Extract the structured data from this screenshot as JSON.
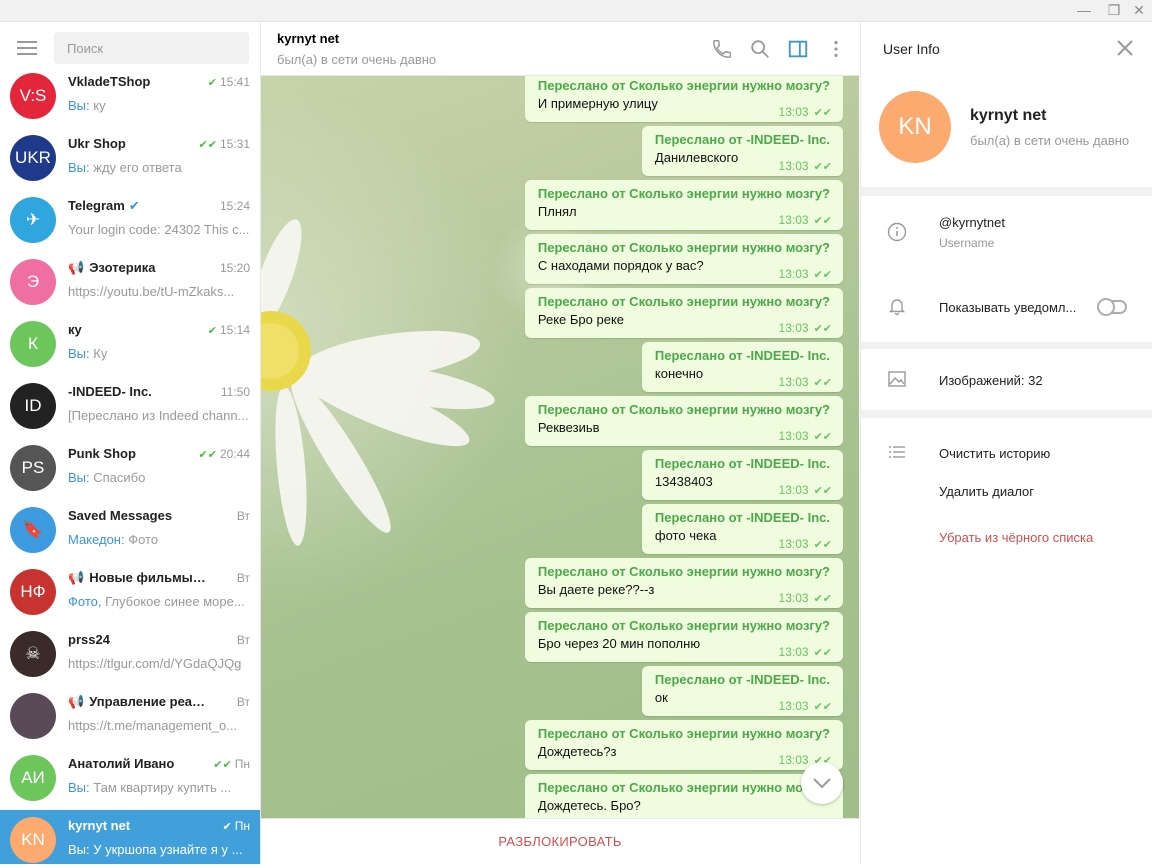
{
  "search": {
    "placeholder": "Поиск"
  },
  "chats": [
    {
      "name": "VkladeTShop",
      "time": "15:41",
      "check": "✔",
      "you": "Вы:",
      "preview": " ку",
      "avatar_text": "V:S",
      "avatar_color": "#e3263a",
      "icon": ""
    },
    {
      "name": "Ukr Shop",
      "time": "15:31",
      "check": "✔✔",
      "you": "Вы:",
      "preview": " жду его ответа",
      "avatar_text": "UKR",
      "avatar_color": "#1f3a8a",
      "icon": ""
    },
    {
      "name": "Telegram",
      "time": "15:24",
      "check": "",
      "you": "",
      "preview": "Your login code: 24302  This c...",
      "avatar_text": "✈",
      "avatar_color": "#2fa6de",
      "icon": "verified"
    },
    {
      "name": "Эзотерика",
      "time": "15:20",
      "check": "",
      "you": "",
      "preview": "https://youtu.be/tU-mZkaks...",
      "avatar_text": "Э",
      "avatar_color": "#ef6fa0",
      "icon": "megaphone"
    },
    {
      "name": "ку",
      "time": "15:14",
      "check": "✔",
      "you": "Вы:",
      "preview": " Ку",
      "avatar_text": "К",
      "avatar_color": "#6dc65b",
      "icon": ""
    },
    {
      "name": "-INDEED- Inc.",
      "time": "11:50",
      "check": "",
      "you": "",
      "preview": "[Переслано из Indeed chann...",
      "avatar_text": "ID",
      "avatar_color": "#222222",
      "icon": ""
    },
    {
      "name": "Punk Shop",
      "time": "20:44",
      "check": "✔✔",
      "you": "Вы:",
      "preview": " Спасибо",
      "avatar_text": "PS",
      "avatar_color": "#555555",
      "icon": ""
    },
    {
      "name": "Saved Messages",
      "time": "Вт",
      "check": "",
      "you": "Македон:",
      "preview": " Фото",
      "avatar_text": "🔖",
      "avatar_color": "#3d9be0",
      "icon": ""
    },
    {
      "name": "Новые фильмы он...",
      "time": "Вт",
      "check": "",
      "you": "Фото,",
      "preview": " Глубокое синее море...",
      "avatar_text": "НФ",
      "avatar_color": "#c7332e",
      "icon": "megaphone"
    },
    {
      "name": "prss24",
      "time": "Вт",
      "check": "",
      "you": "",
      "preview": "https://tlgur.com/d/YGdaQJQg",
      "avatar_text": "☠",
      "avatar_color": "#3a2a2a",
      "icon": ""
    },
    {
      "name": "Управление реальн...",
      "time": "Вт",
      "check": "",
      "you": "",
      "preview": "https://t.me/management_o...",
      "avatar_text": "",
      "avatar_color": "#5a4a58",
      "icon": "megaphone"
    },
    {
      "name": "Анатолий Ивано",
      "time": "Пн",
      "check": "✔✔",
      "you": "Вы:",
      "preview": " Там квартиру купить ...",
      "avatar_text": "АИ",
      "avatar_color": "#6dc65b",
      "icon": ""
    },
    {
      "name": "kyrnyt net",
      "time": "Пн",
      "check": "✔",
      "you": "Вы:",
      "preview": " У укршопа узнайте я у ...",
      "avatar_text": "KN",
      "avatar_color": "#fbaa70",
      "icon": "",
      "active": true
    }
  ],
  "header": {
    "title": "kyrnyt net",
    "status": "был(а) в сети очень давно"
  },
  "messages": [
    {
      "fwd": "Переслано от Сколько энергии нужно мозгу?",
      "text": "И примерную улицу",
      "time": "13:03"
    },
    {
      "fwd": "Переслано от -INDEED- Inc.",
      "text": "Данилевского",
      "time": "13:03"
    },
    {
      "fwd": "Переслано от Сколько энергии нужно мозгу?",
      "text": "Плнял",
      "time": "13:03"
    },
    {
      "fwd": "Переслано от Сколько энергии нужно мозгу?",
      "text": "С находами порядок у вас?",
      "time": "13:03"
    },
    {
      "fwd": "Переслано от Сколько энергии нужно мозгу?",
      "text": "Реке Бро реке",
      "time": "13:03"
    },
    {
      "fwd": "Переслано от -INDEED- Inc.",
      "text": "конечно",
      "time": "13:03"
    },
    {
      "fwd": "Переслано от Сколько энергии нужно мозгу?",
      "text": "Реквезиьв",
      "time": "13:03"
    },
    {
      "fwd": "Переслано от -INDEED- Inc.",
      "text": "13438403",
      "time": "13:03"
    },
    {
      "fwd": "Переслано от -INDEED- Inc.",
      "text": "фото чека",
      "time": "13:03"
    },
    {
      "fwd": "Переслано от Сколько энергии нужно мозгу?",
      "text": "Вы даете реке??--з",
      "time": "13:03"
    },
    {
      "fwd": "Переслано от Сколько энергии нужно мозгу?",
      "text": "Бро через 20 мин пополню",
      "time": "13:03"
    },
    {
      "fwd": "Переслано от -INDEED- Inc.",
      "text": "ок",
      "time": "13:03"
    },
    {
      "fwd": "Переслано от Сколько энергии нужно мозгу?",
      "text": "Дождетесь?з",
      "time": "13:03"
    },
    {
      "fwd": "Переслано от Сколько энергии нужно мозгу?",
      "text": "Дождетесь. Бро?",
      "time": ""
    }
  ],
  "unblock_label": "РАЗБЛОКИРОВАТЬ",
  "info": {
    "title": "User Info",
    "avatar_text": "KN",
    "name": "kyrnyt net",
    "status": "был(а) в сети очень давно",
    "username": "@kyrnytnet",
    "username_label": "Username",
    "notifications": "Показывать уведомл...",
    "images": "Изображений: 32",
    "clear_history": "Очистить историю",
    "delete_dialog": "Удалить диалог",
    "unblacklist": "Убрать из чёрного списка"
  }
}
